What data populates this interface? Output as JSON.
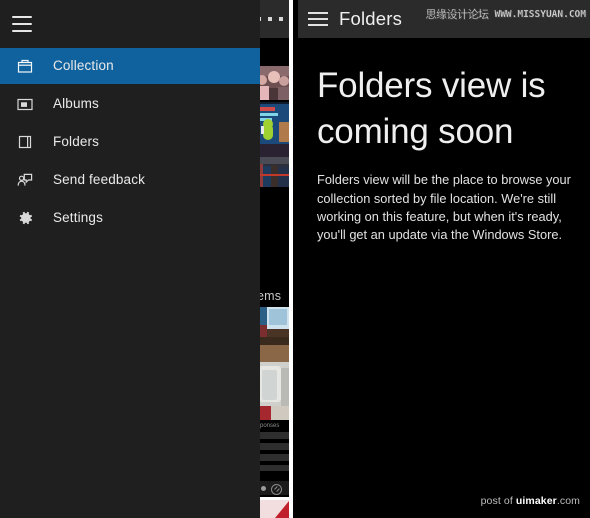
{
  "app": {
    "nav": {
      "menu_icon": "hamburger-icon",
      "items": [
        {
          "label": "Collection",
          "icon": "collection-icon",
          "selected": true
        },
        {
          "label": "Albums",
          "icon": "albums-icon",
          "selected": false
        },
        {
          "label": "Folders",
          "icon": "folders-icon",
          "selected": false
        },
        {
          "label": "Send feedback",
          "icon": "feedback-icon",
          "selected": false
        },
        {
          "label": "Settings",
          "icon": "gear-icon",
          "selected": false
        }
      ]
    },
    "background": {
      "overflow_icon": "ellipsis-icon",
      "partial_count_label": "ems",
      "partial_group_label": "sponses"
    }
  },
  "panel": {
    "menu_icon": "hamburger-icon",
    "title": "Folders",
    "heading": "Folders view is coming soon",
    "description": "Folders view will be the place to browse your collection sorted by file location. We're still working on this feature, but when it's ready, you'll get an update via the Windows Store."
  },
  "watermark": {
    "cn": "思缘设计论坛",
    "url": "WWW.MISSYUAN.COM"
  },
  "credit": {
    "prefix": "post of ",
    "brand": "uimaker",
    "suffix": ".com"
  },
  "colors": {
    "accent": "#10629e",
    "nav_bg": "#1f1f1f",
    "topbar_bg": "#2b2b2b",
    "panel_bg": "#000000",
    "separator": "#ffffff",
    "text_primary": "#efefef"
  }
}
